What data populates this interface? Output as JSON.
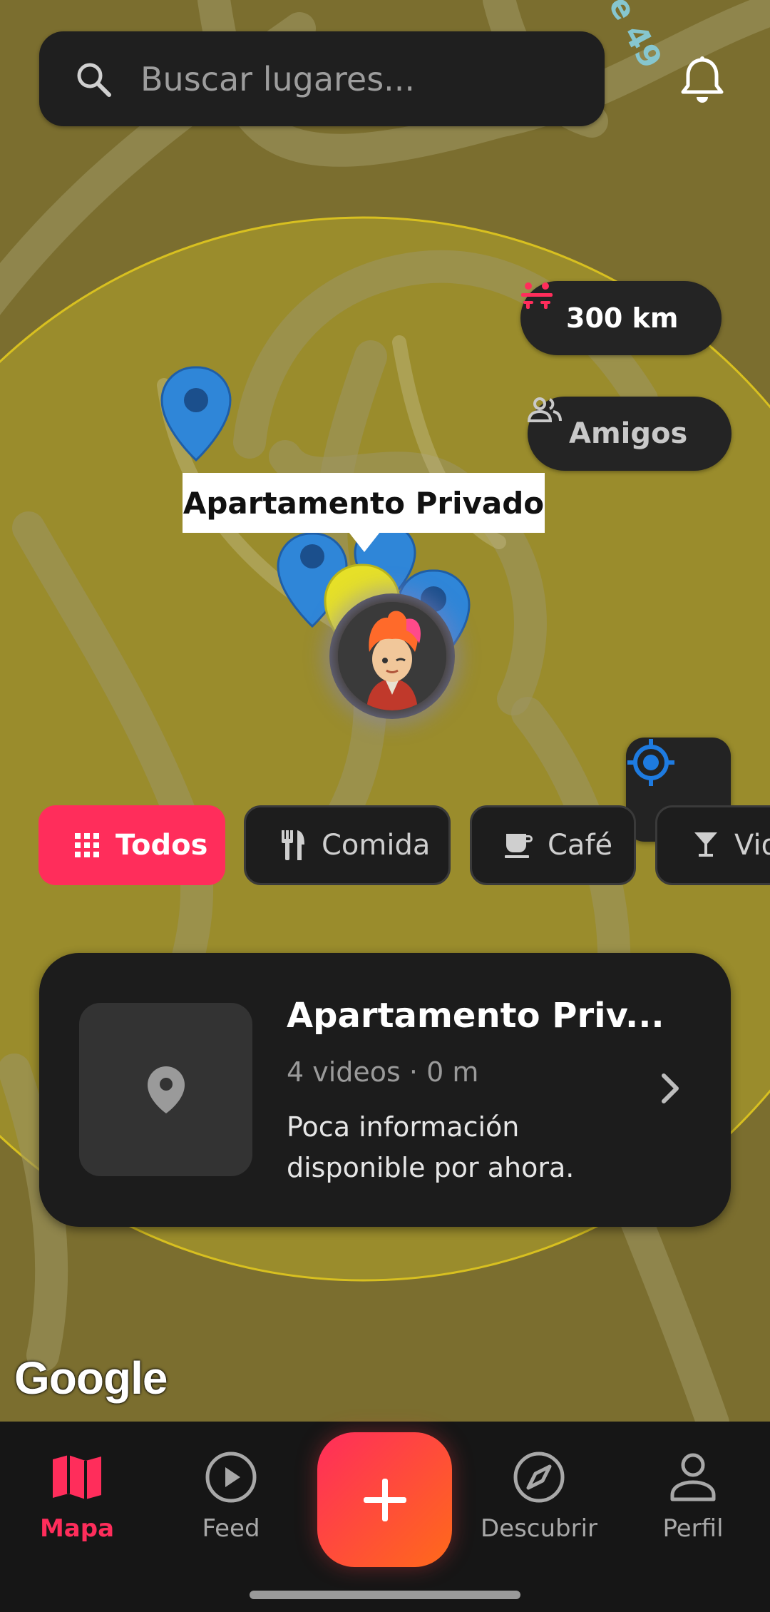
{
  "search": {
    "placeholder": "Buscar lugares..."
  },
  "map": {
    "road_label": "e 49",
    "radius_pill": "300 km",
    "friends_pill": "Amigos",
    "selected_callout": "Apartamento Privado",
    "attribution": "Google"
  },
  "filters": [
    {
      "label": "Todos",
      "icon": "grid-icon",
      "active": true
    },
    {
      "label": "Comida",
      "icon": "utensils-icon",
      "active": false
    },
    {
      "label": "Café",
      "icon": "coffee-icon",
      "active": false
    },
    {
      "label": "Vid",
      "icon": "cocktail-icon",
      "active": false
    }
  ],
  "place_card": {
    "title": "Apartamento Priv...",
    "meta": "4 videos · 0 m",
    "description": "Poca información disponible por ahora."
  },
  "nav": {
    "items": [
      {
        "label": "Mapa",
        "icon": "map-icon",
        "active": true
      },
      {
        "label": "Feed",
        "icon": "play-circle-icon",
        "active": false
      },
      {
        "label": "Descubrir",
        "icon": "compass-icon",
        "active": false
      },
      {
        "label": "Perfil",
        "icon": "person-icon",
        "active": false
      }
    ]
  },
  "colors": {
    "accent": "#ff2d5b",
    "fab_gradient_end": "#ff6a1a",
    "marker_blue": "#2f86d8",
    "radius_fill": "#a8942e"
  }
}
